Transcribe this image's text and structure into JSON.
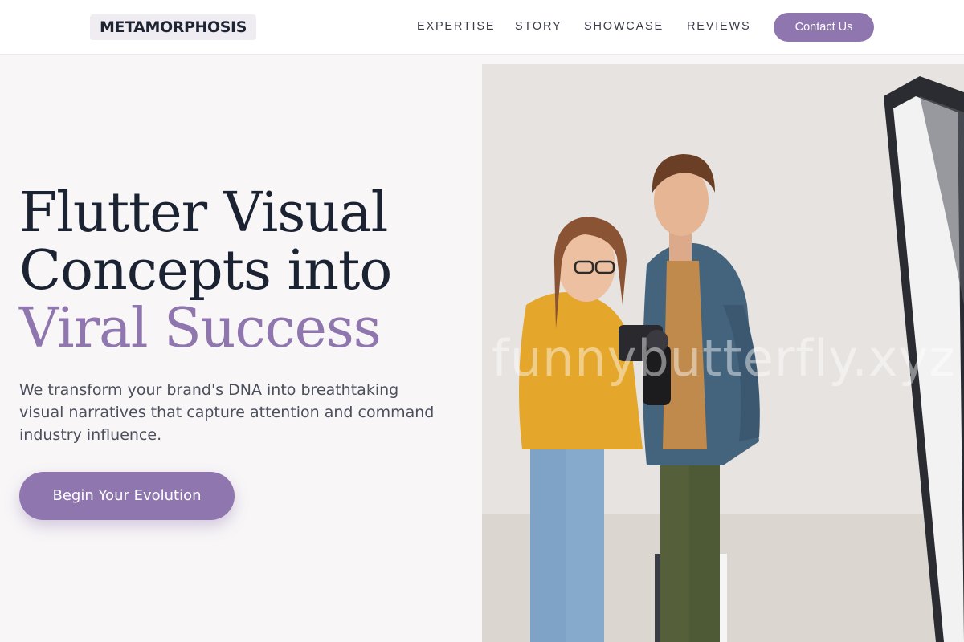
{
  "header": {
    "logo": "METAMORPHOSIS",
    "nav": [
      {
        "label": "EXPERTISE"
      },
      {
        "label": "STORY"
      },
      {
        "label": "SHOWCASE"
      },
      {
        "label": "REVIEWS"
      }
    ],
    "contact_label": "Contact Us"
  },
  "hero": {
    "title_line1": "Flutter Visual",
    "title_line2": "Concepts into",
    "title_accent": "Viral Success",
    "description": "We transform your brand's DNA into breathtaking visual narratives that capture attention and command industry influence.",
    "cta_label": "Begin Your Evolution"
  },
  "image": {
    "subject": "photo-of-two-people-looking-at-camera",
    "watermark": "funnybutterfly.xyz"
  },
  "colors": {
    "accent": "#8f76ae",
    "heading": "#1b2232",
    "background": "#f8f6f7"
  }
}
